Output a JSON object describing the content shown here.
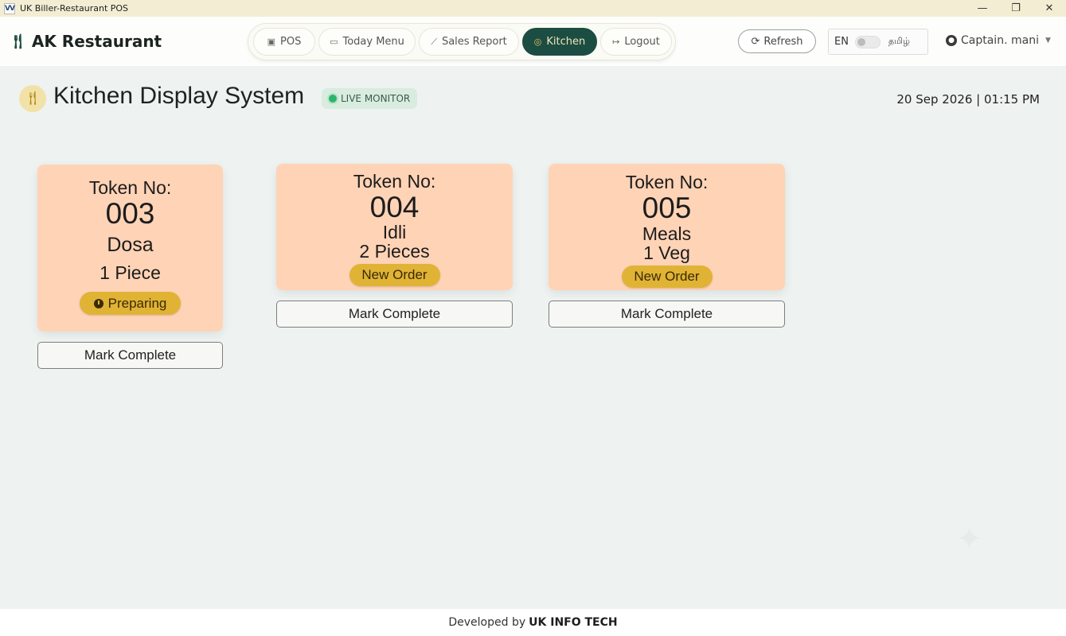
{
  "window": {
    "title": "UK Biller-Restaurant POS",
    "logo_text": "VV",
    "minimize": "—",
    "restore": "❐",
    "close": "✕"
  },
  "header": {
    "brand": "AK Restaurant",
    "brand_icon": "fork-knife-icon",
    "nav": [
      {
        "label": "POS",
        "icon": "pos-icon",
        "active": false
      },
      {
        "label": "Today Menu",
        "icon": "menu-icon",
        "active": false
      },
      {
        "label": "Sales Report",
        "icon": "chart-icon",
        "active": false
      },
      {
        "label": "Kitchen",
        "icon": "kitchen-icon",
        "active": true
      },
      {
        "label": "Logout",
        "icon": "logout-icon",
        "active": false
      }
    ],
    "refresh_label": "Refresh",
    "lang_en": "EN",
    "lang_ta": "தமிழ்",
    "user": "Captain. mani"
  },
  "page": {
    "title": "Kitchen Display System",
    "live_badge": "LIVE MONITOR",
    "datetime": "20 Sep 2026 | 01:15 PM"
  },
  "orders": [
    {
      "token_label": "Token No:",
      "token": "003",
      "item": "Dosa",
      "qty": "1 Piece",
      "status": "Preparing",
      "action": "Mark Complete"
    },
    {
      "token_label": "Token No:",
      "token": "004",
      "item": "Idli",
      "qty": "2 Pieces",
      "status": "New Order",
      "action": "Mark Complete"
    },
    {
      "token_label": "Token No:",
      "token": "005",
      "item": "Meals",
      "qty": "1 Veg",
      "status": "New Order",
      "action": "Mark Complete"
    }
  ],
  "footer": {
    "prefix": "Developed by",
    "company": "UK INFO TECH"
  },
  "colors": {
    "accent": "#1c4d43",
    "card": "#ffd3b6",
    "status": "#e0b335",
    "live": "#2db56a"
  }
}
